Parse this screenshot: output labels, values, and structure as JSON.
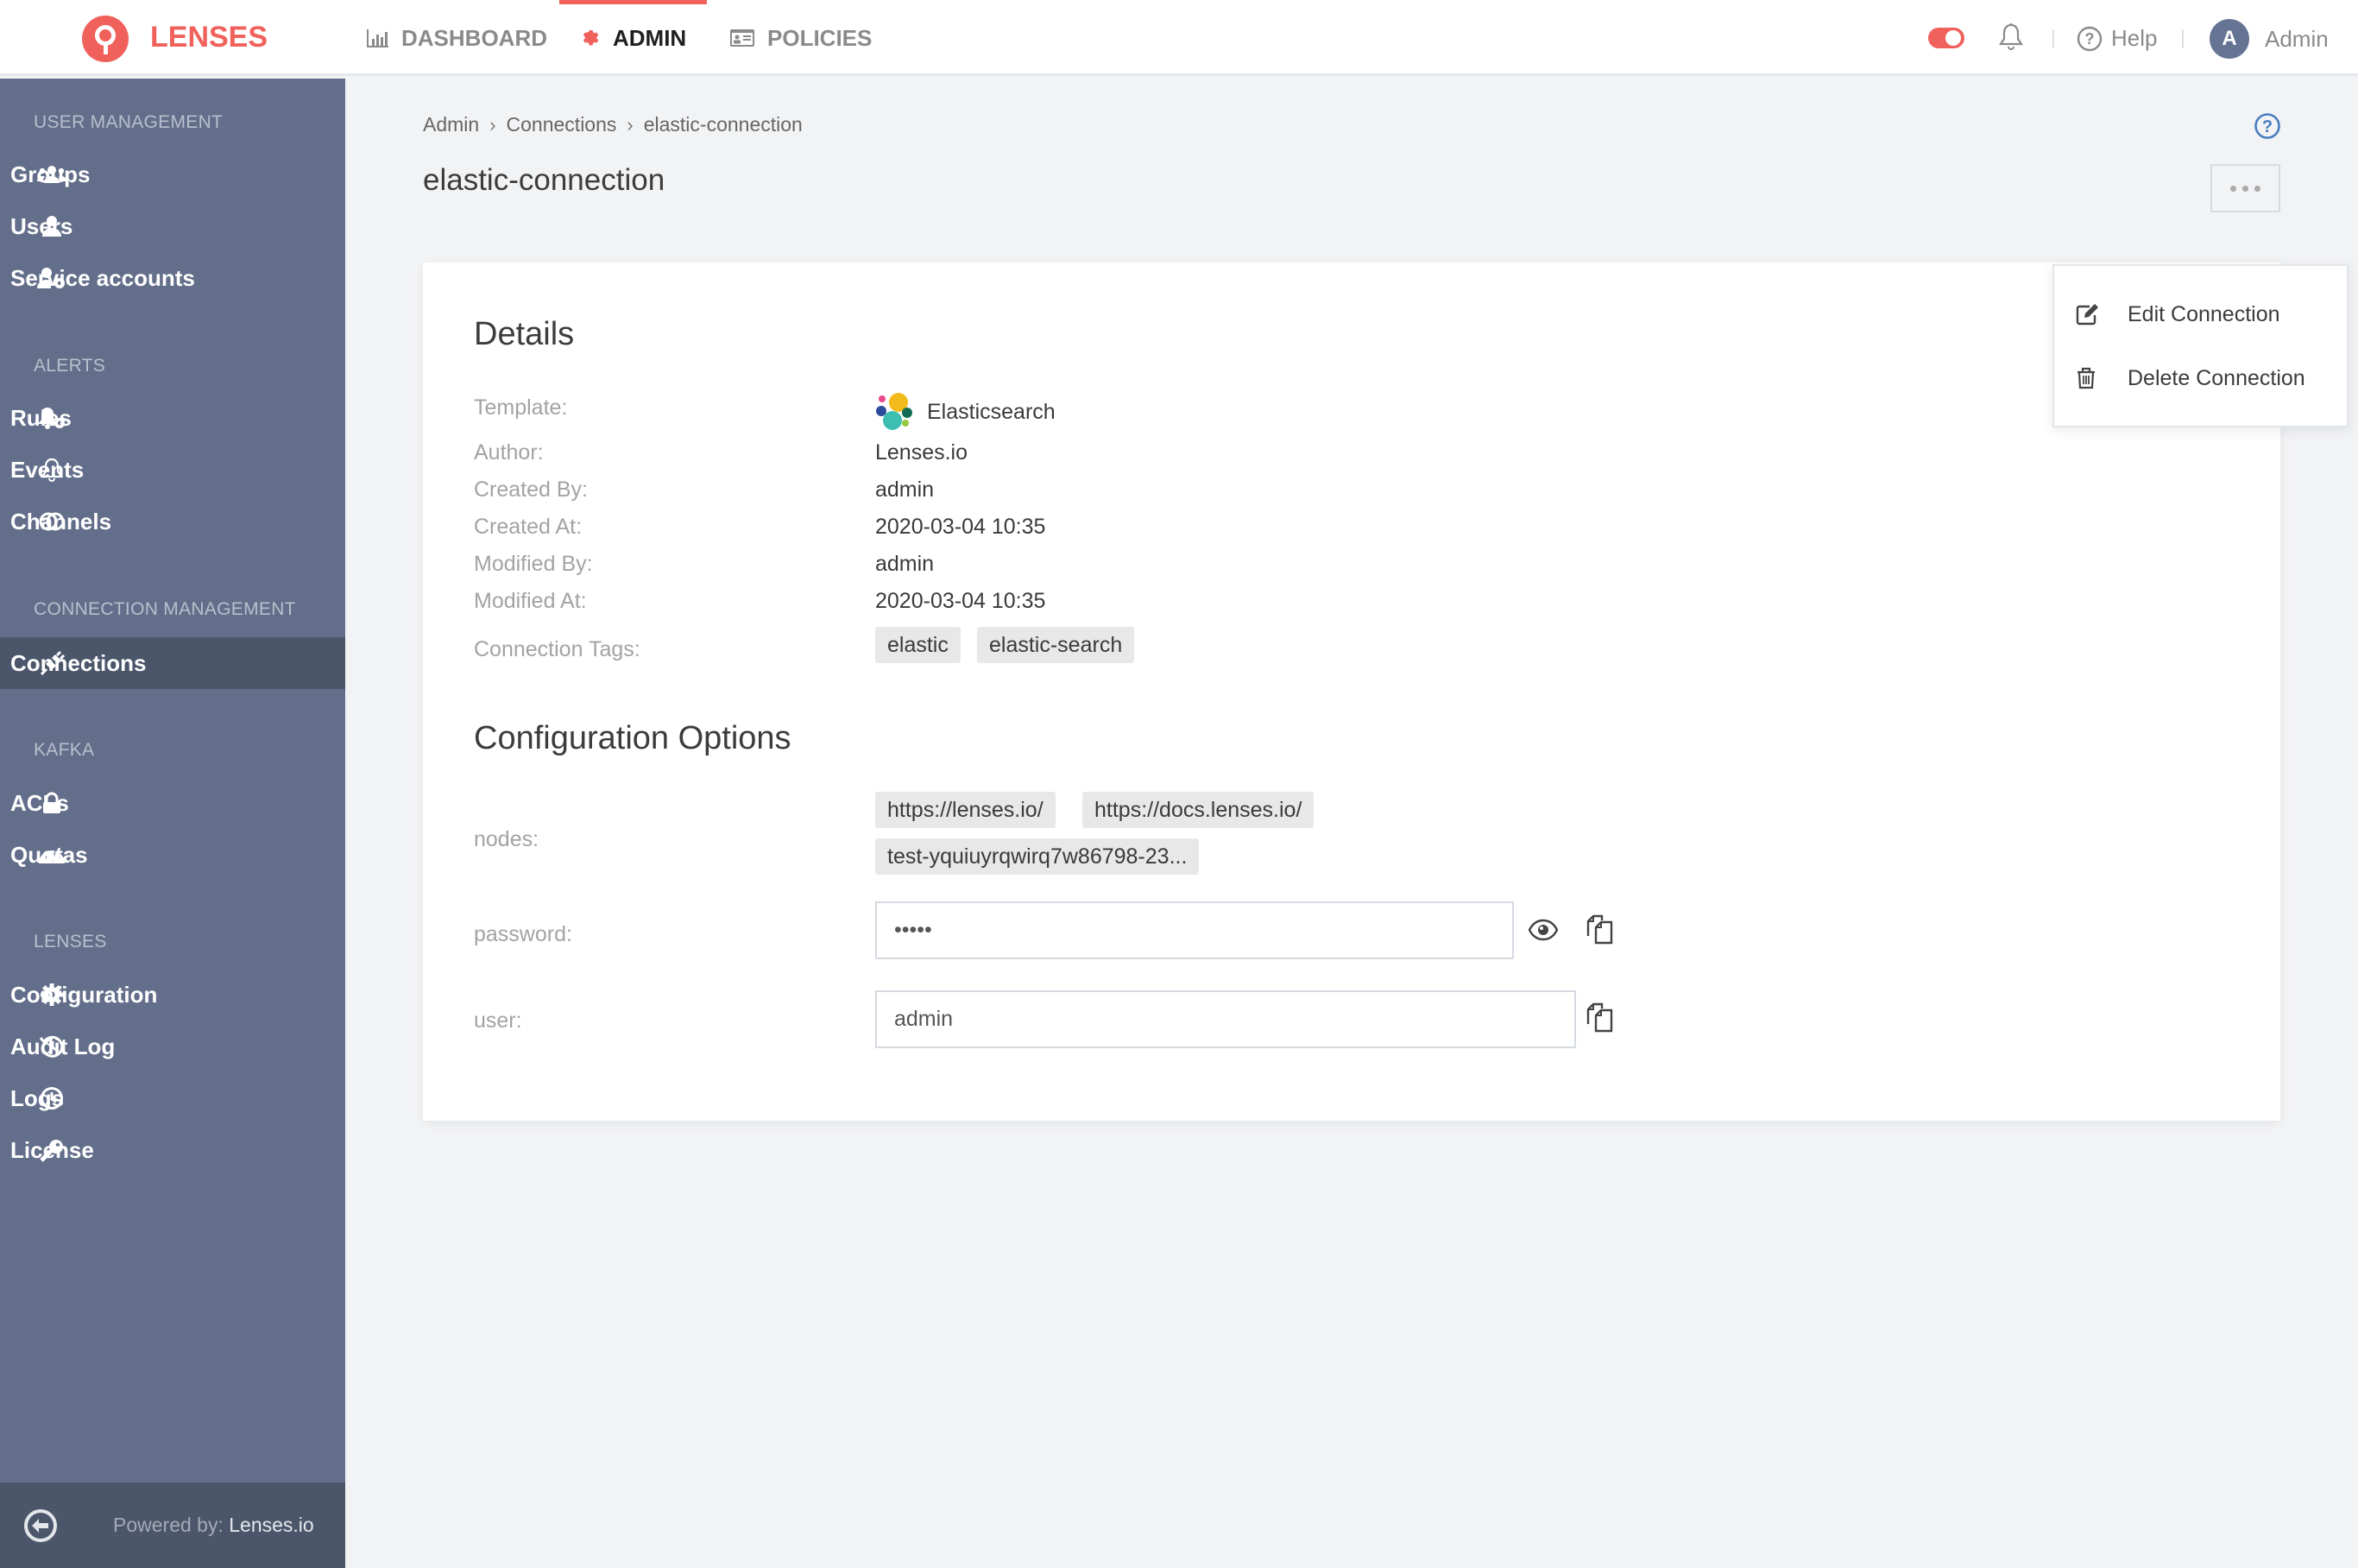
{
  "app": {
    "brand": "LENSES",
    "accent_color": "#f0615c",
    "sidebar_color": "#636e8a"
  },
  "topnav": {
    "tabs": [
      {
        "label": "DASHBOARD",
        "icon": "bar-chart-icon",
        "active": false
      },
      {
        "label": "ADMIN",
        "icon": "gear-icon",
        "active": true
      },
      {
        "label": "POLICIES",
        "icon": "id-card-icon",
        "active": false
      }
    ],
    "toggle_on": true,
    "help_label": "Help",
    "user": {
      "initial": "A",
      "name": "Admin"
    }
  },
  "sidebar": {
    "sections": [
      {
        "title": "USER MANAGEMENT",
        "items": [
          {
            "label": "Groups",
            "icon": "users-icon"
          },
          {
            "label": "Users",
            "icon": "user-icon"
          },
          {
            "label": "Service accounts",
            "icon": "user-cog-icon"
          }
        ]
      },
      {
        "title": "ALERTS",
        "items": [
          {
            "label": "Rules",
            "icon": "bell-cog-icon"
          },
          {
            "label": "Events",
            "icon": "bell-icon"
          },
          {
            "label": "Channels",
            "icon": "channels-icon"
          }
        ]
      },
      {
        "title": "CONNECTION MANAGEMENT",
        "items": [
          {
            "label": "Connections",
            "icon": "plug-icon",
            "active": true
          }
        ]
      },
      {
        "title": "KAFKA",
        "items": [
          {
            "label": "ACLs",
            "icon": "lock-icon"
          },
          {
            "label": "Quotas",
            "icon": "gauge-icon"
          }
        ]
      },
      {
        "title": "LENSES",
        "items": [
          {
            "label": "Configuration",
            "icon": "cog-icon"
          },
          {
            "label": "Audit Log",
            "icon": "history-icon"
          },
          {
            "label": "Logs",
            "icon": "clock-icon"
          },
          {
            "label": "License",
            "icon": "key-icon"
          }
        ]
      }
    ],
    "footer": {
      "powered_prefix": "Powered by:",
      "powered_name": "Lenses.io"
    }
  },
  "breadcrumb": [
    "Admin",
    "Connections",
    "elastic-connection"
  ],
  "page_title": "elastic-connection",
  "menu": {
    "items": [
      {
        "label": "Edit Connection",
        "icon": "edit-icon"
      },
      {
        "label": "Delete Connection",
        "icon": "trash-icon"
      }
    ]
  },
  "details": {
    "title": "Details",
    "rows": [
      {
        "label": "Template:",
        "value": "Elasticsearch"
      },
      {
        "label": "Author:",
        "value": "Lenses.io"
      },
      {
        "label": "Created By:",
        "value": "admin"
      },
      {
        "label": "Created At:",
        "value": "2020-03-04 10:35"
      },
      {
        "label": "Modified By:",
        "value": "admin"
      },
      {
        "label": "Modified At:",
        "value": "2020-03-04 10:35"
      }
    ],
    "tags_label": "Connection Tags:",
    "tags": [
      "elastic",
      "elastic-search"
    ]
  },
  "config": {
    "title": "Configuration Options",
    "nodes_label": "nodes:",
    "nodes": [
      "https://lenses.io/",
      "https://docs.lenses.io/",
      "test-yquiuyrqwirq7w86798-23..."
    ],
    "password_label": "password:",
    "password_value": "•••••",
    "user_label": "user:",
    "user_value": "admin"
  }
}
